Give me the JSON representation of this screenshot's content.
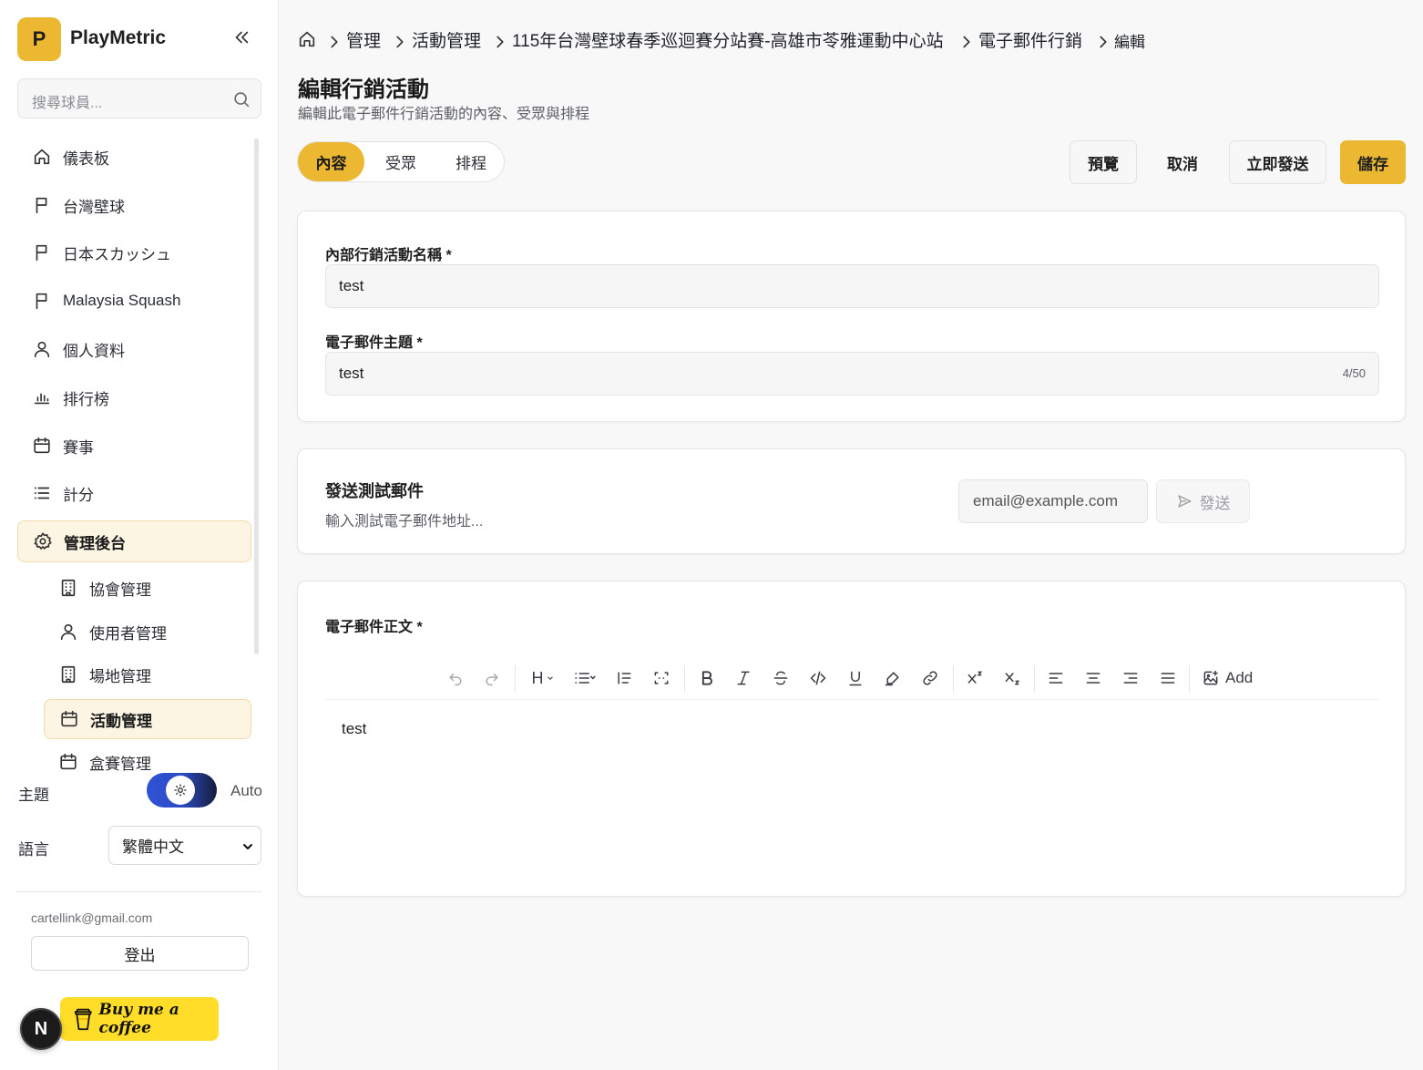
{
  "app": {
    "name": "PlayMetric",
    "logo_letter": "P"
  },
  "search": {
    "placeholder": "搜尋球員..."
  },
  "nav": {
    "items": [
      {
        "label": "儀表板",
        "icon": "home-icon"
      },
      {
        "label": "台灣壁球",
        "icon": "flag-icon"
      },
      {
        "label": "日本スカッシュ",
        "icon": "flag-icon"
      },
      {
        "label": "Malaysia Squash",
        "icon": "flag-icon"
      },
      {
        "label": "個人資料",
        "icon": "user-icon"
      },
      {
        "label": "排行榜",
        "icon": "bar-chart-icon"
      },
      {
        "label": "賽事",
        "icon": "calendar-icon"
      },
      {
        "label": "計分",
        "icon": "list-icon"
      },
      {
        "label": "管理後台",
        "icon": "gear-icon",
        "active": true
      }
    ],
    "sub_items": [
      {
        "label": "協會管理",
        "icon": "building-icon"
      },
      {
        "label": "使用者管理",
        "icon": "user-icon"
      },
      {
        "label": "場地管理",
        "icon": "building-icon"
      },
      {
        "label": "活動管理",
        "icon": "calendar-icon",
        "active": true
      },
      {
        "label": "盒賽管理",
        "icon": "calendar-icon"
      }
    ]
  },
  "theme": {
    "label": "主題",
    "value": "Auto"
  },
  "language": {
    "label": "語言",
    "selected": "繁體中文"
  },
  "user": {
    "email": "cartellink@gmail.com",
    "logout_label": "登出"
  },
  "coffee": {
    "label": "Buy me a coffee"
  },
  "next_badge": {
    "letter": "N"
  },
  "breadcrumb": {
    "items": [
      "管理",
      "活動管理",
      "115年台灣壁球春季巡迴賽分站賽-高雄市苓雅運動中心站",
      "電子郵件行銷",
      "編輯"
    ]
  },
  "page": {
    "title": "編輯行銷活動",
    "subtitle": "編輯此電子郵件行銷活動的內容、受眾與排程"
  },
  "tabs": [
    {
      "label": "內容",
      "active": true
    },
    {
      "label": "受眾"
    },
    {
      "label": "排程"
    }
  ],
  "actions": {
    "preview": "預覽",
    "cancel": "取消",
    "send_now": "立即發送",
    "save": "儲存"
  },
  "form": {
    "name_label": "內部行銷活動名稱 *",
    "name_value": "test",
    "subject_label": "電子郵件主題 *",
    "subject_value": "test",
    "subject_count": "4/50"
  },
  "test_email": {
    "title": "發送測試郵件",
    "subtitle": "輸入測試電子郵件地址...",
    "placeholder": "email@example.com",
    "send_label": "發送"
  },
  "body": {
    "label": "電子郵件正文 *",
    "content": "test",
    "toolbar_add_label": "Add",
    "toolbar_heading_label": "H"
  },
  "colors": {
    "accent": "#ecb731",
    "active_bg": "#fcf5e3"
  }
}
